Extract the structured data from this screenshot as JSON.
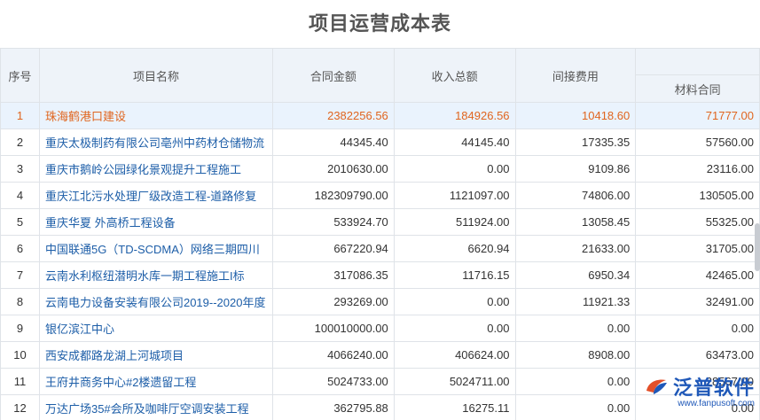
{
  "page": {
    "title": "项目运营成本表"
  },
  "table": {
    "headers": {
      "seq": "序号",
      "name": "项目名称",
      "contract": "合同金额",
      "income": "收入总额",
      "indirect": "间接费用",
      "material": "材料合同"
    },
    "rows": [
      {
        "seq": "1",
        "name": "珠海鹤港口建设",
        "contract": "2382256.56",
        "income": "184926.56",
        "indirect": "10418.60",
        "material": "71777.00"
      },
      {
        "seq": "2",
        "name": "重庆太极制药有限公司亳州中药材仓储物流",
        "contract": "44345.40",
        "income": "44145.40",
        "indirect": "17335.35",
        "material": "57560.00"
      },
      {
        "seq": "3",
        "name": "重庆市鹅岭公园绿化景观提升工程施工",
        "contract": "2010630.00",
        "income": "0.00",
        "indirect": "9109.86",
        "material": "23116.00"
      },
      {
        "seq": "4",
        "name": "重庆江北污水处理厂级改造工程-道路修复",
        "contract": "182309790.00",
        "income": "1121097.00",
        "indirect": "74806.00",
        "material": "130505.00"
      },
      {
        "seq": "5",
        "name": "重庆华夏 外高桥工程设备",
        "contract": "533924.70",
        "income": "511924.00",
        "indirect": "13058.45",
        "material": "55325.00"
      },
      {
        "seq": "6",
        "name": "中国联通5G（TD-SCDMA）网络三期四川",
        "contract": "667220.94",
        "income": "6620.94",
        "indirect": "21633.00",
        "material": "31705.00"
      },
      {
        "seq": "7",
        "name": "云南水利枢纽潜明水库一期工程施工I标",
        "contract": "317086.35",
        "income": "11716.15",
        "indirect": "6950.34",
        "material": "42465.00"
      },
      {
        "seq": "8",
        "name": "云南电力设备安装有限公司2019--2020年度",
        "contract": "293269.00",
        "income": "0.00",
        "indirect": "11921.33",
        "material": "32491.00"
      },
      {
        "seq": "9",
        "name": "银亿滨江中心",
        "contract": "100010000.00",
        "income": "0.00",
        "indirect": "0.00",
        "material": "0.00"
      },
      {
        "seq": "10",
        "name": "西安成都路龙湖上河城项目",
        "contract": "4066240.00",
        "income": "406624.00",
        "indirect": "8908.00",
        "material": "63473.00"
      },
      {
        "seq": "11",
        "name": "王府井商务中心#2楼遗留工程",
        "contract": "5024733.00",
        "income": "5024711.00",
        "indirect": "0.00",
        "material": "28567.00"
      },
      {
        "seq": "12",
        "name": "万达广场35#会所及咖啡厅空调安装工程",
        "contract": "362795.88",
        "income": "16275.11",
        "indirect": "0.00",
        "material": "0.00"
      }
    ]
  },
  "watermark": {
    "brand": "泛普软件",
    "url": "www.fanpusoft.com",
    "logo_icon": "fanpu-logo-icon",
    "color": "#1f58b8"
  }
}
